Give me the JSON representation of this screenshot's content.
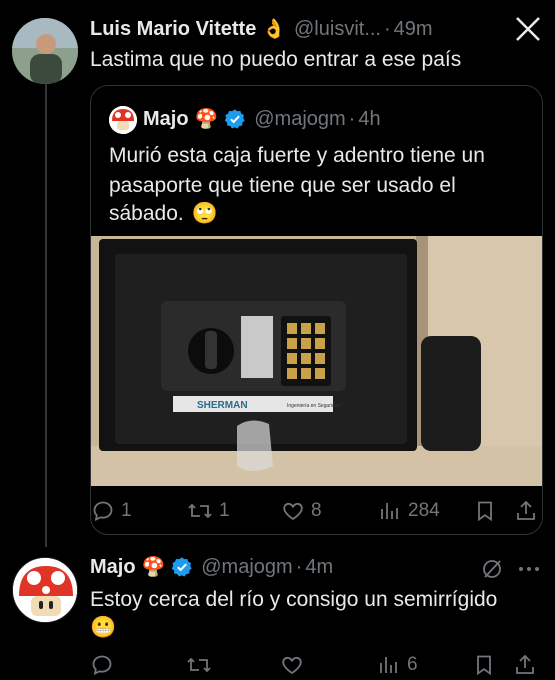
{
  "reply": {
    "name": "Luis Mario Vitette",
    "name_emoji": "👌",
    "handle": "@luisvit...",
    "dot": "·",
    "time": "49m",
    "text": "Lastima que no puedo entrar a ese país"
  },
  "quote": {
    "name": "Majo",
    "name_emoji": "🍄",
    "handle": "@majogm",
    "dot": "·",
    "time": "4h",
    "text_line1": "Murió esta caja fuerte y adentro tiene un",
    "text_line2": "pasaporte que tiene que ser usado el",
    "text_line3": "sábado.",
    "text_emoji": "🙄",
    "image_brand": "SHERMAN",
    "image_caption": "Ingeniería en Seguridad",
    "actions": {
      "replies": "1",
      "retweets": "1",
      "likes": "8",
      "views": "284"
    }
  },
  "main": {
    "name": "Majo",
    "name_emoji": "🍄",
    "handle": "@majogm",
    "dot": "·",
    "time": "4m",
    "text": "Estoy cerca del río y consigo un semirrígido",
    "text_emoji": "😬",
    "actions": {
      "views": "6"
    }
  },
  "colors": {
    "background": "#000000",
    "text": "#e7e9ea",
    "muted": "#71767b",
    "verified": "#1d9bf0",
    "border": "#2f3336"
  },
  "icons": [
    "close-icon",
    "verified-badge-icon",
    "reply-icon",
    "retweet-icon",
    "like-icon",
    "views-icon",
    "bookmark-icon",
    "share-icon",
    "grok-icon",
    "more-icon"
  ]
}
